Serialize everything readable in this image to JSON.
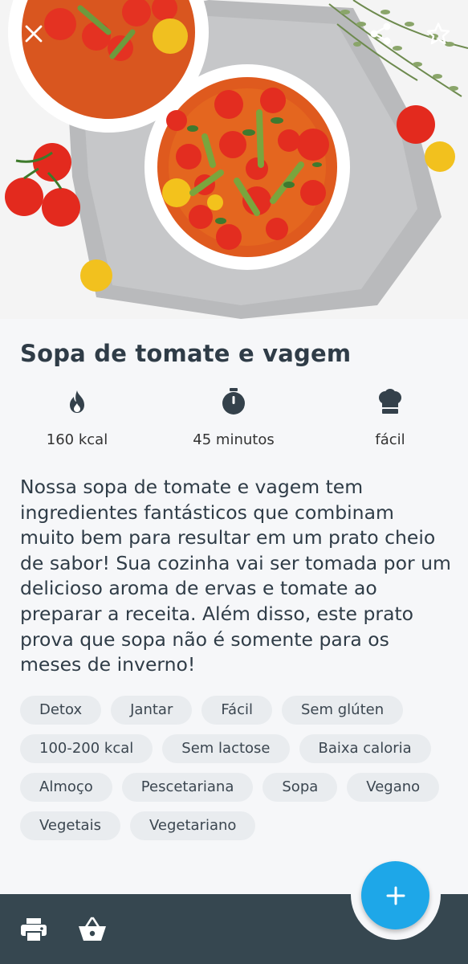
{
  "recipe": {
    "title": "Sopa de tomate e vagem",
    "stats": {
      "calories": "160 kcal",
      "time": "45 minutos",
      "difficulty": "fácil"
    },
    "description": "Nossa sopa de tomate e vagem tem ingredientes fantásticos que combinam muito bem para resultar em um prato cheio de sabor! Sua cozinha vai ser tomada por um delicioso aroma de ervas e tomate ao preparar a receita. Além disso, este prato prova que sopa não é somente para os meses de inverno!",
    "tags": [
      "Detox",
      "Jantar",
      "Fácil",
      "Sem glúten",
      "100-200 kcal",
      "Sem lactose",
      "Baixa caloria",
      "Almoço",
      "Pescetariana",
      "Sopa",
      "Vegano",
      "Vegetais",
      "Vegetariano"
    ]
  },
  "icons": {
    "close": "close-icon",
    "share": "share-icon",
    "favorite": "star-outline-icon",
    "calories": "flame-icon",
    "time": "stopwatch-icon",
    "difficulty": "chef-hat-icon",
    "print": "printer-icon",
    "basket": "basket-icon",
    "add": "plus-icon"
  },
  "colors": {
    "accent": "#1ea7e8",
    "bottom_bar": "#364750",
    "text": "#2f3c47",
    "tag_bg": "#e9ecef"
  }
}
